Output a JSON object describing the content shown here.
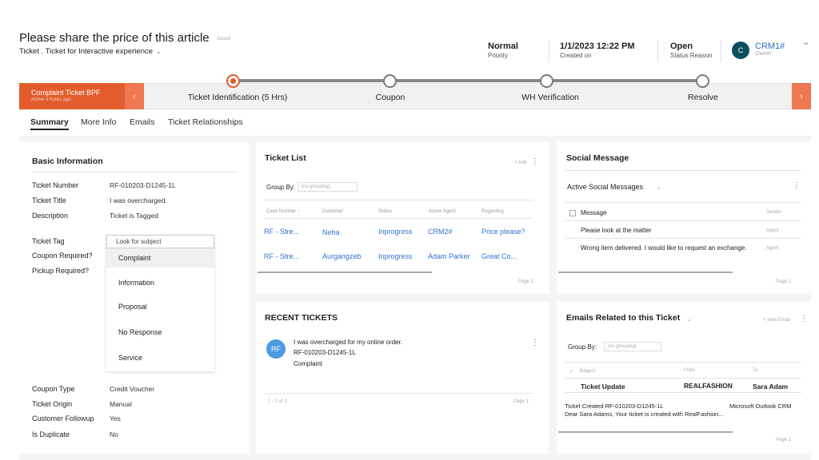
{
  "header": {
    "title": "Please share the price of this article",
    "saved": "Saved",
    "subtitle": "Ticket . Ticket for Interactive experience",
    "priority_value": "Normal",
    "priority_label": "Priority",
    "created_value": "1/1/2023 12:22 PM",
    "created_label": "Created on",
    "status_value": "Open",
    "status_label": "Status Reason",
    "owner_initial": "C",
    "owner_name": "CRM1#",
    "owner_label": "Owner"
  },
  "process": {
    "stage_title": "Complaint Ticket BPF",
    "stage_sub": "Active 5 hours ago",
    "steps": [
      "Ticket Identification (5 Hrs)",
      "Coupon",
      "WH Verification",
      "Resolve"
    ]
  },
  "tabs": [
    "Summary",
    "More Info",
    "Emails",
    "Ticket Relationships"
  ],
  "basic_info": {
    "title": "Basic Information",
    "fields_top": [
      {
        "label": "Ticket Number",
        "value": "RF-010203-D1245-1L"
      },
      {
        "label": "Ticket Title",
        "value": "I was overcharged."
      },
      {
        "label": "Description",
        "value": "Ticket is Tagged"
      }
    ],
    "tag_label": "Ticket Tag",
    "coupon_required_label": "Coupon Required?",
    "pickup_required_label": "Pickup Required?",
    "dropdown_search": "Look for subject",
    "dropdown_options": [
      "Complaint",
      "Information",
      "Proposal",
      "No Response",
      "Service"
    ],
    "fields_bottom": [
      {
        "label": "Coupon Type",
        "value": "Credit Voucher"
      },
      {
        "label": "Ticket Origin",
        "value": "Manual"
      },
      {
        "label": "Customer Followup",
        "value": "Yes"
      },
      {
        "label": "Is Duplicate",
        "value": "No"
      }
    ]
  },
  "ticket_list": {
    "title": "Ticket List",
    "add": "+ Add",
    "group_by": "Group By:",
    "group_by_placeholder": "(no grouping)",
    "columns": [
      "Case Number ↑",
      "Customer",
      "Status",
      "Active Agent",
      "Regarding"
    ],
    "rows": [
      [
        "RF - Stre...",
        "Neha",
        "Inprogress",
        "CRM2#",
        "Price please?"
      ],
      [
        "RF - Stre...",
        "Aurgangzeb",
        "Inprogress",
        "Adam Parker",
        "Great Co..."
      ]
    ],
    "pager": "Page 1"
  },
  "social": {
    "title": "Social Message",
    "view": "Active Social Messages",
    "col_message": "Message",
    "col_sender": "Sender",
    "rows": [
      {
        "message": "Please look at the matter",
        "sender": "Agent"
      },
      {
        "message": "Wrong item delivered. I would like to request an exchange.",
        "sender": "Agent"
      }
    ],
    "pager": "Page 1"
  },
  "recent": {
    "title": "RECENT TICKETS",
    "avatar": "RF",
    "line1": "I was overcharged for my online order.",
    "line2": "RF-010203-D1245-1L",
    "line3": "Complaint",
    "count": "1 - 1 of 1",
    "pager": "Page 1"
  },
  "emails": {
    "title": "Emails Related to this Ticket",
    "new": "+ New Email",
    "group_by": "Group By:",
    "group_by_placeholder": "(no grouping)",
    "col_subject": "Subject",
    "col_from": "From",
    "col_to": "To",
    "subject": "Ticket Update",
    "from": "REALFASHION",
    "to": "Sara Adam",
    "body1": "Ticket Created RF-010203-D1245-1L",
    "body2": "Dear Sara Adams, Your ticket is created with RealFashion...",
    "body_right": "Microsoft Outlook CRM",
    "pager": "Page 1"
  }
}
